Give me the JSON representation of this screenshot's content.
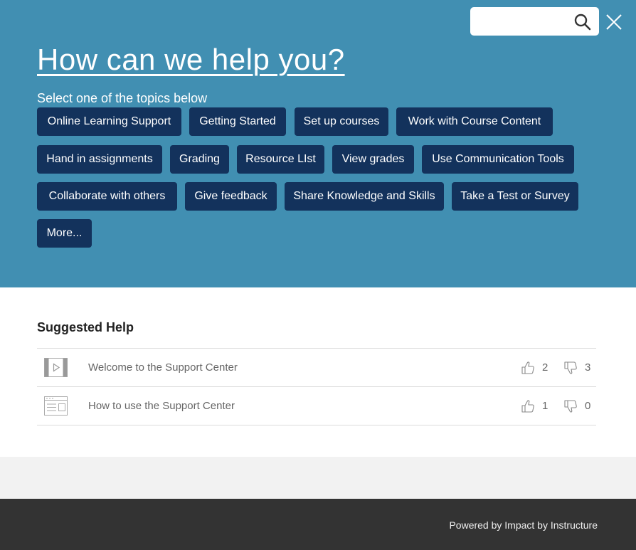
{
  "search": {
    "value": "",
    "placeholder": "",
    "icon": "search-icon",
    "close_icon": "close-icon"
  },
  "hero": {
    "title": "How can we help you?",
    "subtitle": "Select one of the topics below",
    "background_color": "#418fb2",
    "button_color": "#13325c",
    "topics": [
      {
        "label": "Online Learning Support"
      },
      {
        "label": "Getting Started"
      },
      {
        "label": "Set up courses"
      },
      {
        "label": "Work with Course Content"
      },
      {
        "label": "Hand in assignments"
      },
      {
        "label": "Grading"
      },
      {
        "label": "Resource LIst"
      },
      {
        "label": "View grades"
      },
      {
        "label": "Use Communication Tools"
      },
      {
        "label": "Collaborate with others"
      },
      {
        "label": "Give feedback"
      },
      {
        "label": "Share Knowledge and Skills"
      },
      {
        "label": "Take a Test or Survey"
      },
      {
        "label": "More..."
      }
    ]
  },
  "suggested": {
    "title": "Suggested Help",
    "items": [
      {
        "type_icon": "video-icon",
        "title": "Welcome to the Support Center",
        "likes": "2",
        "dislikes": "3"
      },
      {
        "type_icon": "article-icon",
        "title": "How to use the Support Center",
        "likes": "1",
        "dislikes": "0"
      }
    ]
  },
  "footer": {
    "text": "Powered by Impact by Instructure"
  }
}
